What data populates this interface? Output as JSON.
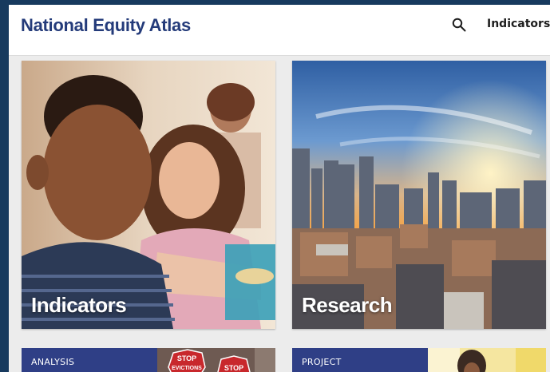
{
  "header": {
    "logo": "National Equity Atlas",
    "search_icon": "search-icon",
    "nav_indicators": "Indicators"
  },
  "cards": [
    {
      "title": "Indicators",
      "image": "children-classroom-photo"
    },
    {
      "title": "Research",
      "image": "city-skyline-sunset-photo"
    }
  ],
  "bottom_cards": [
    {
      "tag": "ANALYSIS",
      "thumb_text_1": "STOP",
      "thumb_text_2": "EVICTIONS",
      "thumb_text_3": "STOP"
    },
    {
      "tag": "PROJECT",
      "image": "person-photo"
    }
  ],
  "colors": {
    "brand_navy": "#243b7a",
    "band_blue": "#2f3f86",
    "outer_bg": "#173a5e"
  }
}
